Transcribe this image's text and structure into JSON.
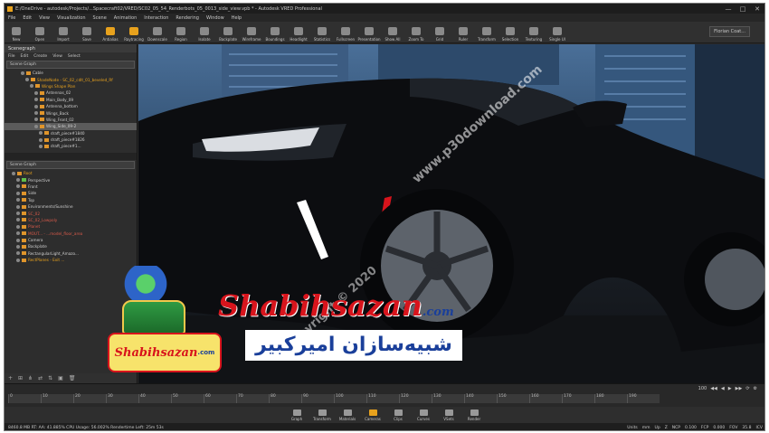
{
  "window": {
    "title": "E:/OneDrive - autodesk/Projects/...Spacecraft02/VRED/SC02_05_54_Renderbots_05_0013_side_view.vpb * - Autodesk VRED Professional",
    "controls": [
      "—",
      "□",
      "✕"
    ]
  },
  "menu": [
    "File",
    "Edit",
    "View",
    "Visualization",
    "Scene",
    "Animation",
    "Interaction",
    "Rendering",
    "Window",
    "Help"
  ],
  "toolbar": {
    "tools": [
      "New",
      "Open",
      "Import",
      "Save",
      "Antialias",
      "Raytracing",
      "Downscale",
      "Region",
      "Isolate",
      "Backplate",
      "Wireframe",
      "Boundings",
      "Headlight",
      "Statistics",
      "Fullscreen",
      "Presentation",
      "Show All",
      "Zoom To",
      "Grid",
      "Ruler",
      "Transform",
      "Selection",
      "Texturing",
      "Single UI"
    ],
    "accent_tools": [
      "Antialias",
      "Raytracing"
    ],
    "user_select": "Florian Coat..."
  },
  "scenegraph": {
    "title": "Scenegraph",
    "menu": [
      "File",
      "Edit",
      "Create",
      "View",
      "Select"
    ],
    "dropdown": "Scene Graph",
    "rows": [
      {
        "label": "Cable",
        "indent": 3,
        "style": ""
      },
      {
        "label": "ShadeNode - SC_02_cdlt_01_beveled_Rf",
        "indent": 4,
        "style": "orange"
      },
      {
        "label": "Wings Shape Plan",
        "indent": 5,
        "style": "orange"
      },
      {
        "label": "Antennas_02",
        "indent": 6,
        "style": ""
      },
      {
        "label": "Main_Body_09",
        "indent": 6,
        "style": ""
      },
      {
        "label": "Antenna_bottom",
        "indent": 6,
        "style": ""
      },
      {
        "label": "Wings_Back",
        "indent": 6,
        "style": ""
      },
      {
        "label": "Wing_Front_02",
        "indent": 6,
        "style": ""
      },
      {
        "label": "Wing_Side_09-2",
        "indent": 6,
        "style": "sel"
      },
      {
        "label": "draft_piece#1840",
        "indent": 7,
        "style": ""
      },
      {
        "label": "draft_piece#1826",
        "indent": 7,
        "style": ""
      },
      {
        "label": "draft_piece#1...",
        "indent": 7,
        "style": ""
      }
    ]
  },
  "scenegraph2": {
    "dropdown": "Scene Graph",
    "rows": [
      {
        "label": "Root",
        "indent": 1,
        "style": "orange"
      },
      {
        "label": "Perspective",
        "indent": 2,
        "style": "green"
      },
      {
        "label": "Front",
        "indent": 2,
        "style": ""
      },
      {
        "label": "Side",
        "indent": 2,
        "style": ""
      },
      {
        "label": "Top",
        "indent": 2,
        "style": ""
      },
      {
        "label": "Environments/Sunshine",
        "indent": 2,
        "style": ""
      },
      {
        "label": "SC_02",
        "indent": 2,
        "style": "red"
      },
      {
        "label": "SC_02_Lowpoly",
        "indent": 2,
        "style": "red"
      },
      {
        "label": "Planet",
        "indent": 2,
        "style": "red"
      },
      {
        "label": "MOUT... - ...model_floor_area",
        "indent": 2,
        "style": "red"
      },
      {
        "label": "Camera",
        "indent": 2,
        "style": ""
      },
      {
        "label": "Backplate",
        "indent": 2,
        "style": ""
      },
      {
        "label": "RectangularLight_Amazo...",
        "indent": 2,
        "style": ""
      },
      {
        "label": "RectPlanes - Exit ...",
        "indent": 2,
        "style": "orange"
      }
    ],
    "mini_tools": [
      "+",
      "⊞",
      "⋔",
      "⇄",
      "⇅",
      "▣",
      "🗑"
    ]
  },
  "viewport": {
    "watermark_url": "www.p30download.com",
    "watermark_copy": "Copyright © 2020",
    "brand_latin": "Shabihsazan",
    "brand_domain": ".com",
    "brand_farsi": "شبیه‌سازان امیرکبیر",
    "logo_text": "Shabihsazan",
    "logo_domain": ".com"
  },
  "timeline": {
    "controls": [
      "100",
      "◀◀",
      "◀",
      "▶",
      "▶▶",
      "⟳",
      "⚙"
    ],
    "ticks": [
      "0",
      "10",
      "20",
      "30",
      "40",
      "50",
      "60",
      "70",
      "80",
      "90",
      "100",
      "110",
      "120",
      "130",
      "140",
      "150",
      "160",
      "170",
      "180",
      "190"
    ]
  },
  "dock": {
    "items": [
      "Graph",
      "Transform",
      "Materials",
      "Cameras",
      "Clips",
      "Curves",
      "VSets",
      "Render"
    ],
    "accent": [
      "Cameras"
    ]
  },
  "status": {
    "left": "8460.8 MB  RT: AA: 41.885%  CPU Usage: 56.002%  Rendertime Left: 25m 53s",
    "right": [
      "Units",
      "mm",
      "Up",
      "Z",
      "NCP",
      "0.100",
      "FCP",
      "0.000",
      "FOV",
      "35.8",
      "ICV"
    ]
  },
  "colors": {
    "accent": "#e8a21d",
    "brand_red": "#d8141c",
    "brand_blue": "#1a3f9a"
  }
}
